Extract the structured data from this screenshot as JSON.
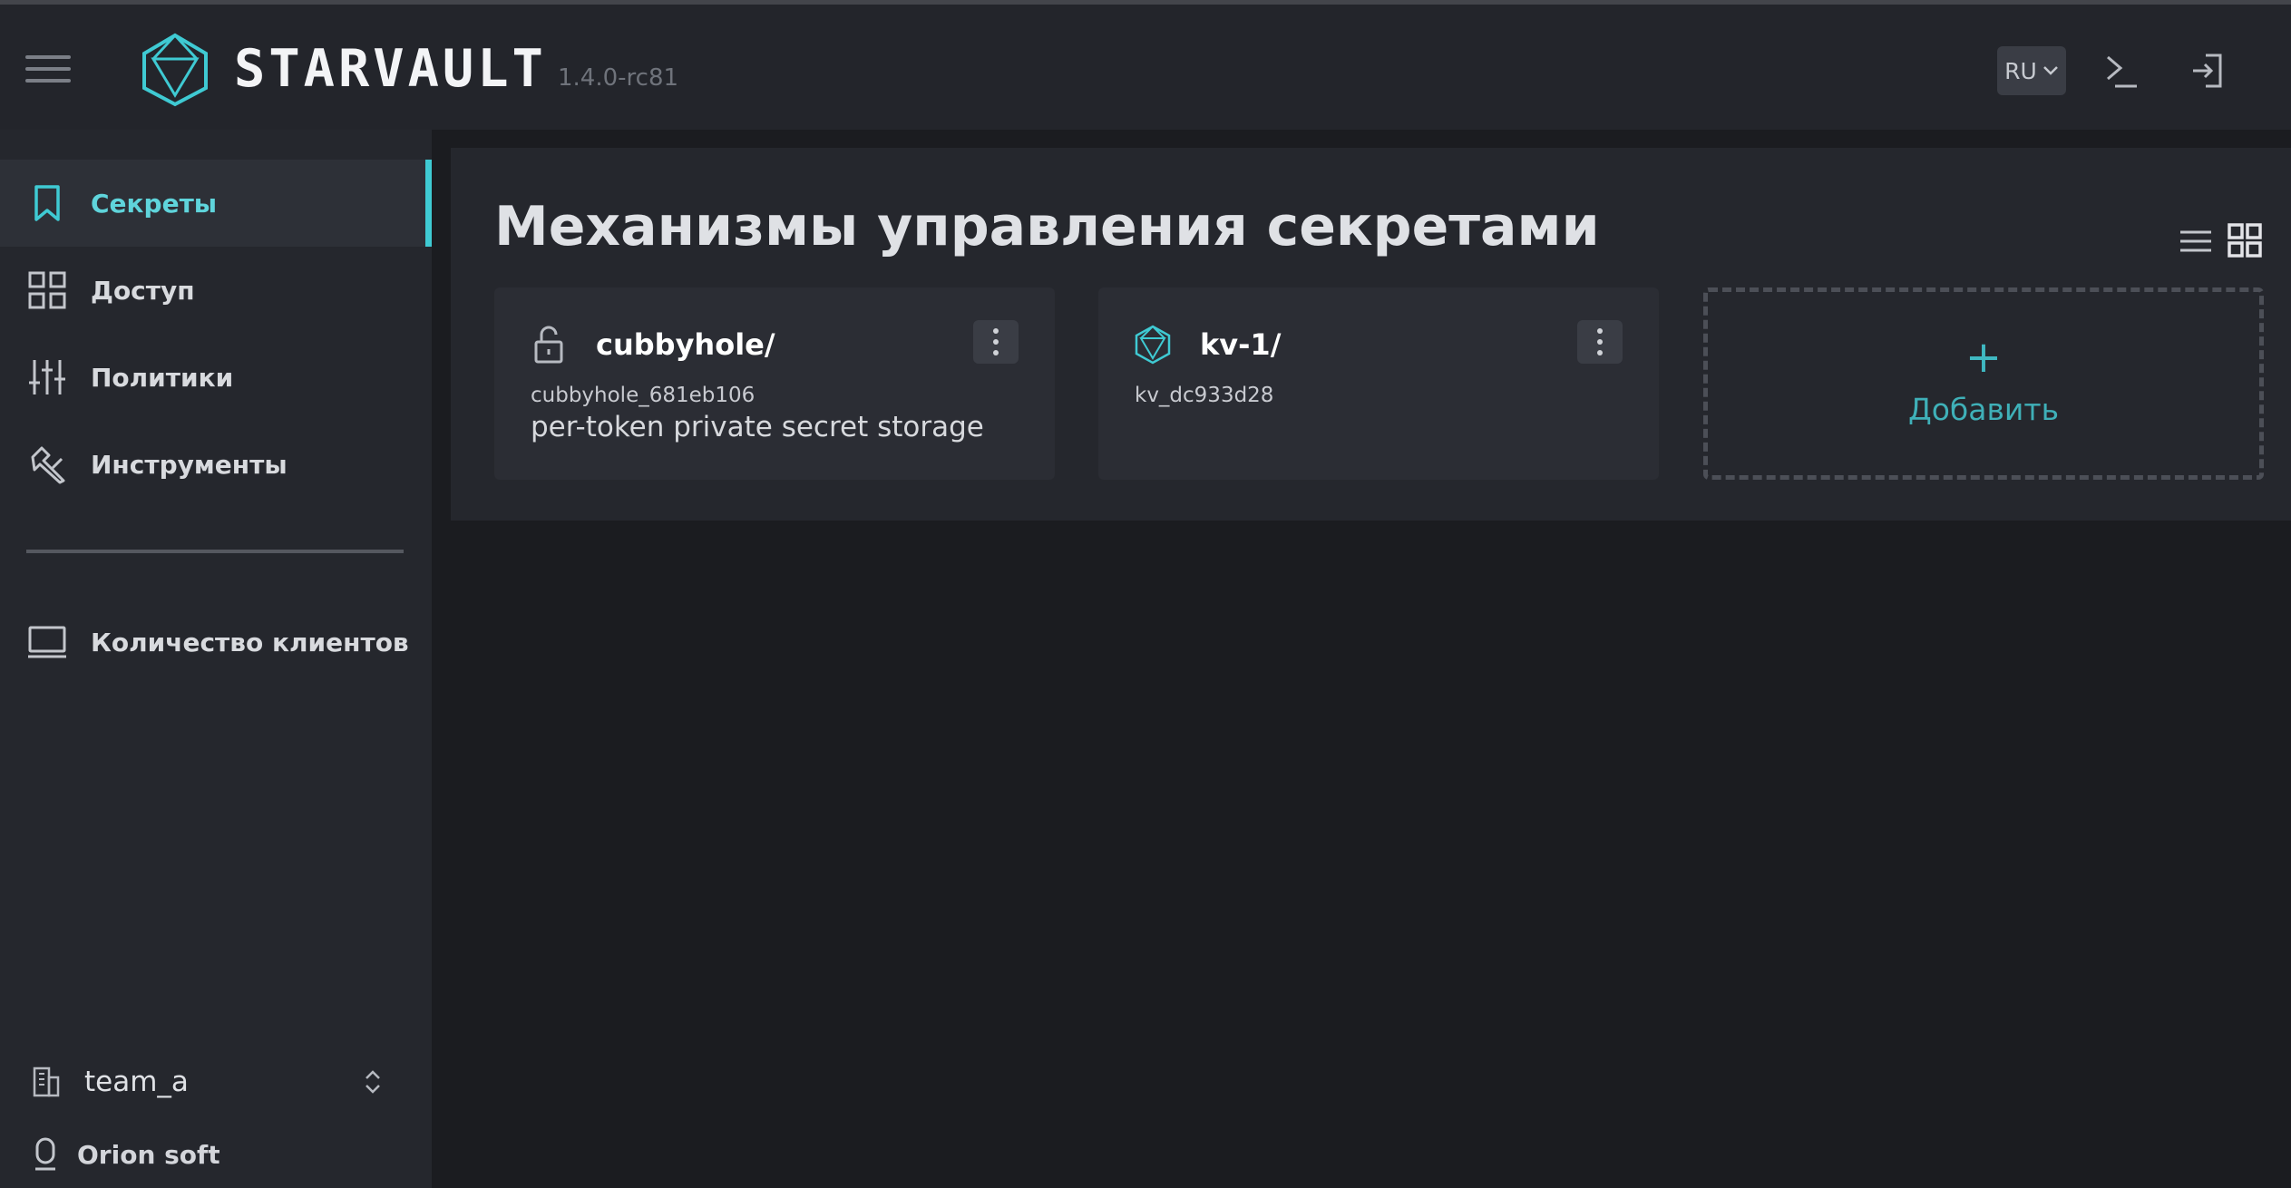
{
  "header": {
    "brand": "STARVAULT",
    "version": "1.4.0-rc81",
    "language": "RU"
  },
  "sidebar": {
    "items": [
      {
        "label": "Секреты",
        "icon": "bookmark-icon",
        "active": true
      },
      {
        "label": "Доступ",
        "icon": "grid-icon",
        "active": false
      },
      {
        "label": "Политики",
        "icon": "sliders-icon",
        "active": false
      },
      {
        "label": "Инструменты",
        "icon": "tools-icon",
        "active": false
      }
    ],
    "clients_label": "Количество клиентов",
    "namespace": "team_a",
    "vendor": "Orion soft"
  },
  "main": {
    "title": "Механизмы управления секретами",
    "cards": [
      {
        "title": "cubbyhole/",
        "id": "cubbyhole_681eb106",
        "description": "per-token private secret storage",
        "icon": "unlock-icon"
      },
      {
        "title": "kv-1/",
        "id": "kv_dc933d28",
        "description": "",
        "icon": "kv-engine-icon"
      }
    ],
    "add_plus": "+",
    "add_label": "Добавить"
  },
  "colors": {
    "accent": "#3fcad3",
    "background": "#1b1c20",
    "surface": "#25272d",
    "card": "#2b2d34"
  }
}
